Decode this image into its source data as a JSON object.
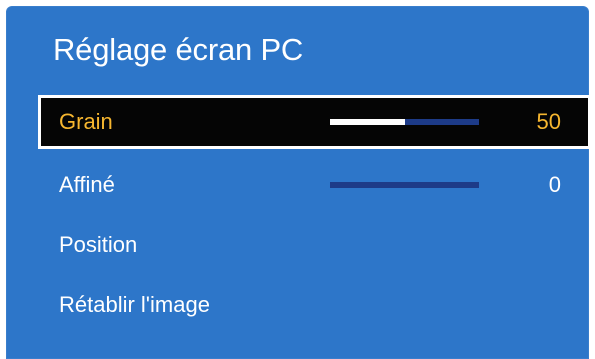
{
  "menu": {
    "title": "Réglage écran PC",
    "items": [
      {
        "label": "Grain",
        "value": "50",
        "level": 0.5,
        "selected": true
      },
      {
        "label": "Affiné",
        "value": "0",
        "level": 0,
        "selected": false
      },
      {
        "label": "Position"
      },
      {
        "label": "Rétablir l'image"
      }
    ]
  },
  "colors": {
    "panel_background": "#2d76c9",
    "selection_background": "#050505",
    "selection_border": "#ffffff",
    "selected_text": "#f6b62f",
    "normal_text": "#ffffff",
    "slider_track": "#1d3b88",
    "slider_fill": "#ffffff"
  }
}
